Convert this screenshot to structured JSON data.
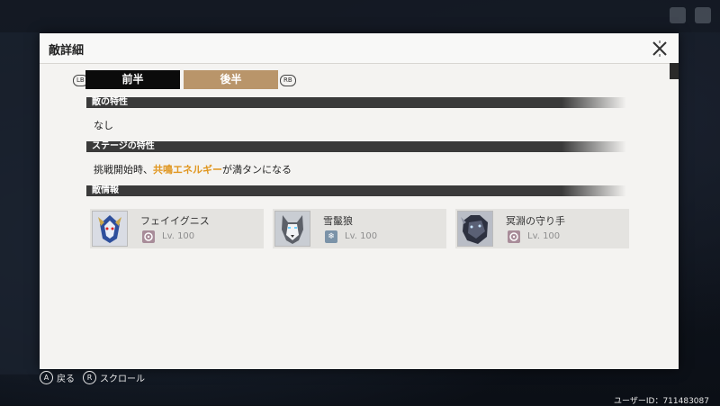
{
  "panel": {
    "title": "敵詳細"
  },
  "tabs": {
    "left_shoulder": "LB",
    "right_shoulder": "RB",
    "items": [
      {
        "label": "前半",
        "state": "inactive"
      },
      {
        "label": "後半",
        "state": "active"
      }
    ]
  },
  "sections": {
    "enemy_traits": {
      "heading": "敵の特性",
      "text": "なし"
    },
    "stage_traits": {
      "heading": "ステージの特性",
      "text_before": "挑戦開始時、",
      "text_highlight": "共鳴エネルギー",
      "text_after": "が満タンになる"
    },
    "enemy_info": {
      "heading": "敵情報"
    }
  },
  "enemies": [
    {
      "name": "フェイイグニス",
      "level": "Lv. 100",
      "attribute_icon": "vortex-glyph-icon",
      "attribute_color": "#a88c99"
    },
    {
      "name": "雪鬣狼",
      "level": "Lv. 100",
      "attribute_icon": "snowflake-icon",
      "attribute_color": "#7b93a8"
    },
    {
      "name": "冥淵の守り手",
      "level": "Lv. 100",
      "attribute_icon": "vortex-glyph-icon",
      "attribute_color": "#a88c99"
    }
  ],
  "footer": {
    "back_key": "A",
    "back_label": "戻る",
    "scroll_key": "R",
    "scroll_label": "スクロール",
    "user_id": "ユーザーID：711483087"
  },
  "colors": {
    "accent_tab": "#b9956a",
    "highlight_text": "#e0961f",
    "section_bar": "#3a3a3a"
  }
}
